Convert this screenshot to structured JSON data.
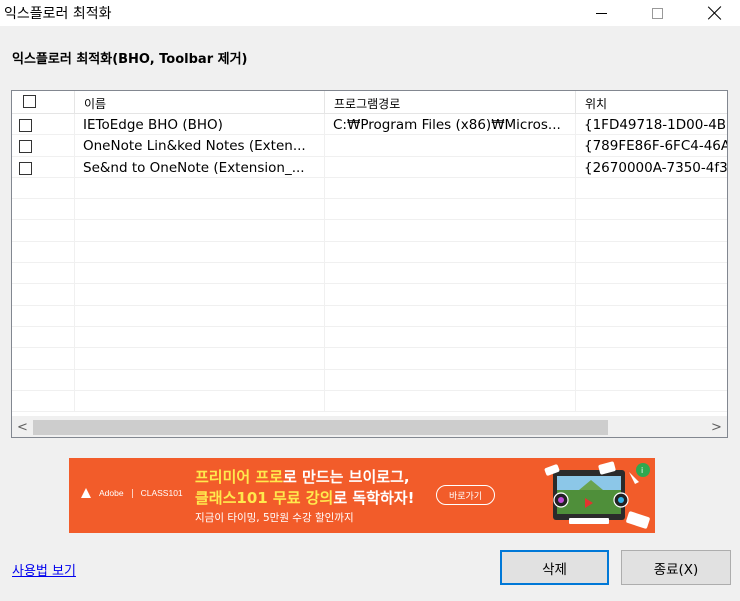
{
  "window": {
    "title": "익스플로러 최적화",
    "controls": {
      "minimize": "minimize-icon",
      "maximize": "maximize-icon",
      "close": "close-icon"
    }
  },
  "heading": "익스플로러 최적화(BHO, Toolbar 제거)",
  "list": {
    "columns": [
      "이름",
      "프로그램경로",
      "위치"
    ],
    "rows": [
      {
        "checked": false,
        "name": "IEToEdge BHO (BHO)",
        "path": "C:₩Program Files (x86)₩Micros...",
        "location": "{1FD49718-1D00-4B1"
      },
      {
        "checked": false,
        "name": "OneNote Lin&ked Notes (Exten...",
        "path": "",
        "location": "{789FE86F-6FC4-46A"
      },
      {
        "checked": false,
        "name": "Se&nd to OneNote (Extension_...",
        "path": "",
        "location": "{2670000A-7350-4f3"
      }
    ],
    "empty_row_count": 11,
    "scrollbar": {
      "left_arrow": "<",
      "right_arrow": ">"
    }
  },
  "ad": {
    "brand_adobe": "Adobe",
    "brand_class101": "CLASS101",
    "line1_highlight": "프리미어 프로",
    "line1_rest": "로 만드는 브이로그,",
    "line2_highlight": "클래스101 무료 강의",
    "line2_rest": "로 독학하자!",
    "line3": "지금이 타이밍, 5만원 수강 할인까지",
    "cta": "바로가기",
    "colors": {
      "background": "#f25c2a",
      "highlight": "#ffe94d"
    }
  },
  "footer": {
    "help_link": "사용법 보기",
    "delete_button": "삭제",
    "exit_button": "종료(X)"
  }
}
